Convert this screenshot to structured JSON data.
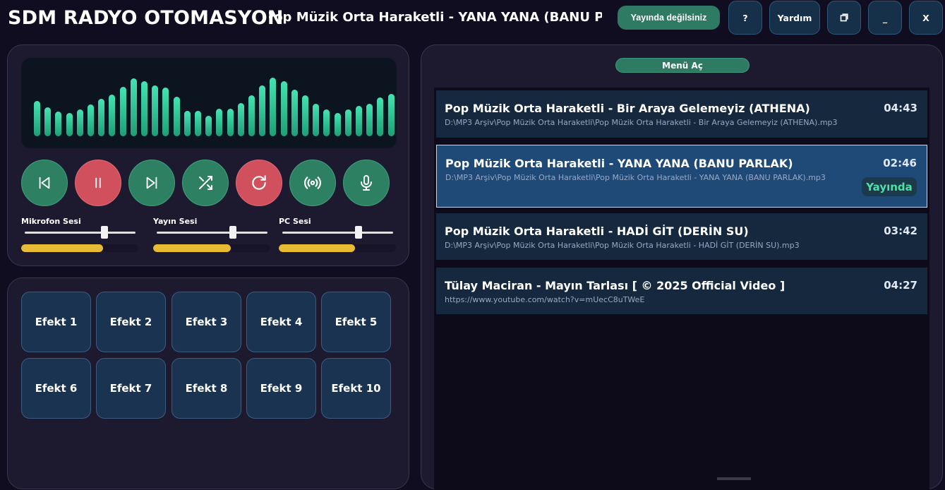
{
  "app": {
    "title": "SDM RADYO OTOMASYON",
    "now_playing": "Pop Müzik Orta Haraketli - YANA YANA (BANU PARLAK)"
  },
  "titlebar": {
    "live_status": "Yayında değilsiniz",
    "question_label": "?",
    "help_label": "Yardım",
    "restore_icon": "restore-icon",
    "minimize_label": "_",
    "close_label": "X"
  },
  "visualizer": {
    "levels": [
      0.5,
      0.41,
      0.35,
      0.33,
      0.38,
      0.45,
      0.53,
      0.59,
      0.7,
      0.82,
      0.78,
      0.72,
      0.69,
      0.56,
      0.36,
      0.36,
      0.29,
      0.39,
      0.39,
      0.47,
      0.58,
      0.72,
      0.83,
      0.78,
      0.66,
      0.58,
      0.46,
      0.38,
      0.33,
      0.38,
      0.43,
      0.46,
      0.55,
      0.6
    ],
    "color_start": "#1f9e78",
    "color_end": "#45e3b2"
  },
  "controls": [
    {
      "name": "previous-button",
      "icon": "skip-back-icon"
    },
    {
      "name": "pause-button",
      "icon": "pause-icon"
    },
    {
      "name": "next-button",
      "icon": "skip-forward-icon"
    },
    {
      "name": "shuffle-button",
      "icon": "shuffle-icon"
    },
    {
      "name": "repeat-button",
      "icon": "repeat-icon"
    },
    {
      "name": "broadcast-button",
      "icon": "broadcast-icon"
    },
    {
      "name": "microphone-button",
      "icon": "microphone-icon"
    }
  ],
  "sliders": [
    {
      "label": "Mikrofon Sesi",
      "volume": 0.72,
      "meter": 0.7
    },
    {
      "label": "Yayın Sesi",
      "volume": 0.69,
      "meter": 0.66
    },
    {
      "label": "PC Sesi",
      "volume": 0.69,
      "meter": 0.65
    }
  ],
  "effects": [
    "Efekt 1",
    "Efekt 2",
    "Efekt 3",
    "Efekt 4",
    "Efekt 5",
    "Efekt 6",
    "Efekt 7",
    "Efekt 8",
    "Efekt 9",
    "Efekt 10"
  ],
  "playlist": {
    "menu_label": "Menü Aç",
    "tracks": [
      {
        "title": "Pop Müzik Orta Haraketli - Bir Araya Gelemeyiz (ATHENA)",
        "path": "D:\\MP3 Arşiv\\Pop Müzik Orta Haraketli\\Pop Müzik Orta Haraketli - Bir Araya Gelemeyiz (ATHENA).mp3",
        "duration": "04:43",
        "active": false
      },
      {
        "title": "Pop Müzik Orta Haraketli - YANA YANA (BANU PARLAK)",
        "path": "D:\\MP3 Arşiv\\Pop Müzik Orta Haraketli\\Pop Müzik Orta Haraketli - YANA YANA (BANU PARLAK).mp3",
        "duration": "02:46",
        "active": true,
        "badge": "Yayında"
      },
      {
        "title": "Pop Müzik Orta Haraketli - HADİ GİT (DERİN SU)",
        "path": "D:\\MP3 Arşiv\\Pop Müzik Orta Haraketli\\Pop Müzik Orta Haraketli - HADİ GİT (DERİN SU).mp3",
        "duration": "03:42",
        "active": false
      },
      {
        "title": "Tülay Maciran - Mayın Tarlası [ © 2025 Official Video ]",
        "path": "https://www.youtube.com/watch?v=mUecC8uTWeE",
        "duration": "04:27",
        "active": false
      }
    ]
  },
  "colors": {
    "background": "#0f0d1f",
    "panel": "#1d1a30",
    "accent_green": "#2e8062",
    "accent_red": "#d0505e",
    "meter_yellow": "#e8bb34",
    "active_track": "#1f4a77",
    "live_badge_text": "#4ee0a6"
  }
}
